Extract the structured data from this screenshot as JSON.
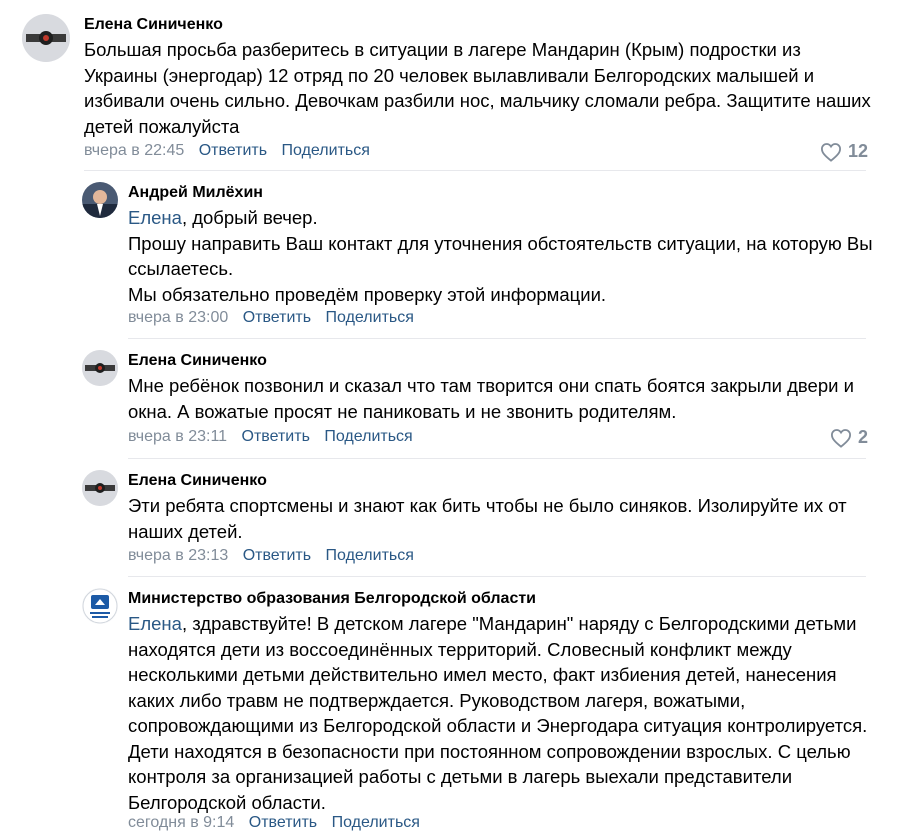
{
  "comments": [
    {
      "author": "Елена Синиченко",
      "text": "Большая просьба разберитесь в ситуации в лагере Мандарин (Крым) подростки из Украины (энергодар) 12 отряд по 20 человек вылавливали Белгородских малышей и избивали очень сильно. Девочкам разбили нос, мальчику сломали ребра. Защитите наших детей пожалуйста",
      "time": "вчера в 22:45",
      "reply_label": "Ответить",
      "share_label": "Поделиться",
      "likes": "12"
    },
    {
      "author": "Андрей Милёхин",
      "mention": "Елена",
      "text_line1": ", добрый вечер.",
      "text_line2": "Прошу направить Ваш контакт для уточнения обстоятельств ситуации, на которую Вы ссылаетесь.",
      "text_line3": "Мы обязательно проведём проверку этой информации.",
      "time": "вчера в 23:00",
      "reply_label": "Ответить",
      "share_label": "Поделиться"
    },
    {
      "author": "Елена Синиченко",
      "text": "Мне ребёнок позвонил и сказал что там творится они спать боятся закрыли двери и окна. А вожатые просят не паниковать и не звонить родителям.",
      "time": "вчера в 23:11",
      "reply_label": "Ответить",
      "share_label": "Поделиться",
      "likes": "2"
    },
    {
      "author": "Елена Синиченко",
      "text": "Эти ребята спортсмены и знают как бить чтобы не было синяков. Изолируйте их от наших детей.",
      "time": "вчера в 23:13",
      "reply_label": "Ответить",
      "share_label": "Поделиться"
    },
    {
      "author": "Министерство образования Белгородской области",
      "mention": "Елена",
      "text": ", здравствуйте! В детском лагере \"Мандарин\" наряду с Белгородскими детьми находятся дети из воссоединённых территорий. Словесный конфликт между несколькими детьми действительно имел место, факт избиения детей, нанесения каких либо травм не подтверждается. Руководством лагеря, вожатыми, сопровождающими из Белгородской области и Энергодара ситуация контролируется. Дети находятся в безопасности при постоянном сопровождении взрослых. С целью контроля за организацией работы с детьми в лагерь выехали представители Белгородской области.",
      "time": "сегодня в 9:14",
      "reply_label": "Ответить",
      "share_label": "Поделиться"
    }
  ],
  "colors": {
    "link": "#2a5885",
    "meta": "#818c99",
    "divider": "#e7e8ec"
  }
}
